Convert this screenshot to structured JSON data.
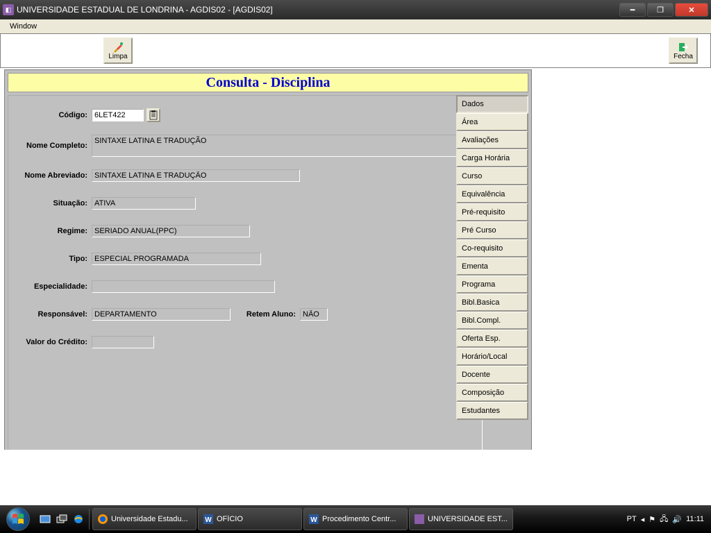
{
  "titlebar": {
    "text": "UNIVERSIDADE ESTADUAL DE LONDRINA - AGDIS02 - [AGDIS02]"
  },
  "menubar": {
    "window": "Window"
  },
  "toolbar": {
    "limpa": "Limpa",
    "fecha": "Fecha"
  },
  "header": {
    "title": "Consulta - Disciplina"
  },
  "form": {
    "labels": {
      "codigo": "Código:",
      "nome_completo": "Nome Completo:",
      "nome_abreviado": "Nome Abreviado:",
      "situacao": "Situação:",
      "regime": "Regime:",
      "tipo": "Tipo:",
      "especialidade": "Especialidade:",
      "responsavel": "Responsável:",
      "retem_aluno": "Retem Aluno:",
      "valor_credito": "Valor do Crédito:"
    },
    "values": {
      "codigo": "6LET422",
      "nome_completo": "SINTAXE LATINA E TRADUÇÃO",
      "nome_abreviado": "SINTAXE LATINA E TRADUÇÃO",
      "situacao": "ATIVA",
      "regime": "SERIADO ANUAL(PPC)",
      "tipo": "ESPECIAL PROGRAMADA",
      "especialidade": "",
      "responsavel": "DEPARTAMENTO",
      "retem_aluno": "NÃO",
      "valor_credito": ""
    }
  },
  "tabs": [
    "Dados",
    "Área",
    "Avaliações",
    "Carga Horária",
    "Curso",
    "Equivalência",
    "Pré-requisito",
    "Pré Curso",
    "Co-requisito",
    "Ementa",
    "Programa",
    "Bibl.Basica",
    "Bibl.Compl.",
    "Oferta Esp.",
    "Horário/Local",
    "Docente",
    "Composição",
    "Estudantes"
  ],
  "taskbar": {
    "items": [
      "Universidade Estadu...",
      "OFÍCIO",
      "Procedimento Centr...",
      "UNIVERSIDADE EST..."
    ],
    "lang": "PT",
    "time": "11:11"
  }
}
